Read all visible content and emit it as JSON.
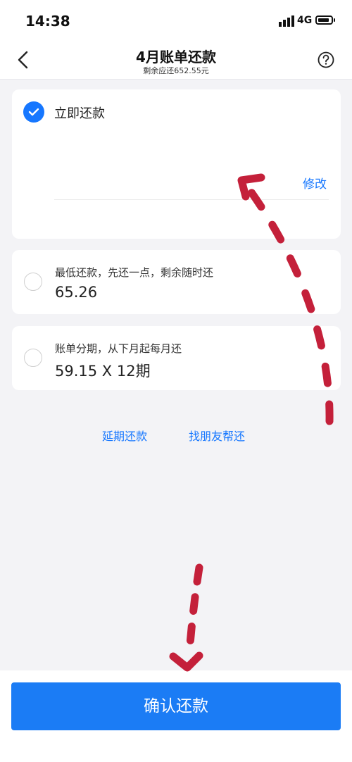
{
  "status_bar": {
    "time": "14:38",
    "network": "4G",
    "icons": [
      "signal-icon",
      "battery-icon"
    ]
  },
  "nav": {
    "title": "4月账单还款",
    "subtitle": "剩余应还652.55元",
    "icons": [
      "back-chevron-icon",
      "help-icon"
    ]
  },
  "options": {
    "pay_now": {
      "label": "立即还款",
      "selected": true,
      "modify_link": "修改"
    },
    "minimum": {
      "label": "最低还款，先还一点，剩余随时还",
      "value": "65.26",
      "selected": false
    },
    "installment": {
      "label": "账单分期，从下月起每月还",
      "value": "59.15 X 12期",
      "selected": false
    }
  },
  "links": {
    "extend": "延期还款",
    "ask_friend": "找朋友帮还"
  },
  "confirm_button": "确认还款",
  "colors": {
    "accent": "#1677ff",
    "button": "#1b7cf5",
    "annotation_arrows": "#c4203a",
    "background": "#f3f3f6"
  }
}
